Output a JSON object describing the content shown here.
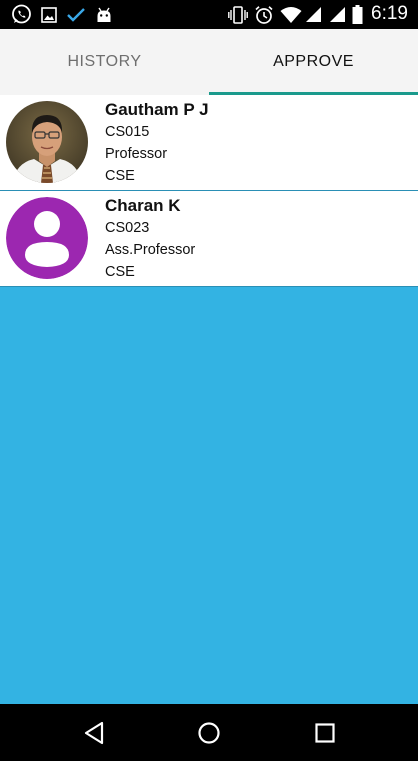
{
  "status_bar": {
    "time": "6:19",
    "left_icons": [
      "whatsapp-icon",
      "image-icon",
      "check-icon",
      "android-icon"
    ],
    "right_icons": [
      "vibrate-icon",
      "alarm-icon",
      "wifi-icon",
      "cell-signal-icon",
      "cell-signal-icon",
      "battery-icon"
    ]
  },
  "tabs": [
    {
      "label": "HISTORY",
      "selected": false
    },
    {
      "label": "APPROVE",
      "selected": true
    }
  ],
  "colors": {
    "accent": "#1a9a8c",
    "background": "#33b3e3",
    "avatar_placeholder": "#9c27b0"
  },
  "list": [
    {
      "name": "Gautham P J",
      "id": "CS015",
      "designation": "Professor",
      "department": "CSE",
      "avatar": "photo"
    },
    {
      "name": "Charan K",
      "id": "CS023",
      "designation": "Ass.Professor",
      "department": "CSE",
      "avatar": "default-person-icon"
    }
  ],
  "nav_bar": {
    "buttons": [
      "back-icon",
      "home-icon",
      "recents-icon"
    ]
  }
}
